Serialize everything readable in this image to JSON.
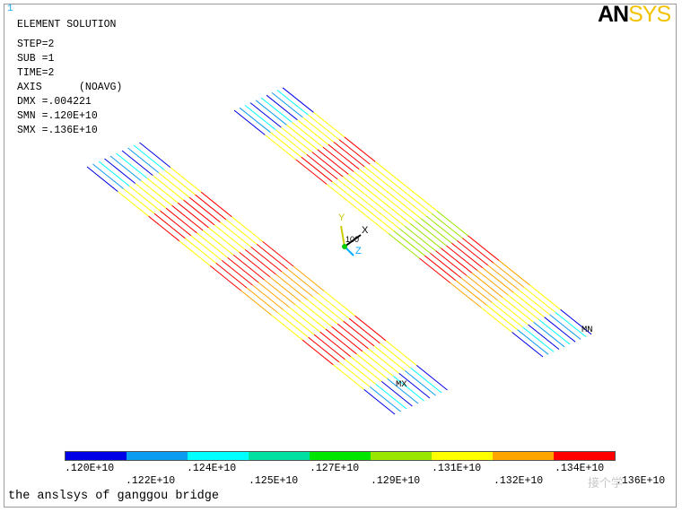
{
  "window_number": "1",
  "logo": {
    "black": "AN",
    "yellow": "SYS"
  },
  "info": {
    "heading": "ELEMENT SOLUTION",
    "lines": [
      "STEP=2",
      "SUB =1",
      "TIME=2",
      "AXIS      (NOAVG)",
      "DMX =.004221",
      "SMN =.120E+10",
      "SMX =.136E+10"
    ]
  },
  "markers": {
    "mx": "MX",
    "mn": "MN"
  },
  "triad": {
    "x": "X",
    "y": "Y",
    "z": "Z",
    "num": "100"
  },
  "legend": {
    "colors": [
      "#0000e6",
      "#0a9cf0",
      "#00ffff",
      "#00e0a0",
      "#00e600",
      "#99e600",
      "#ffff00",
      "#ffa500",
      "#ff0000"
    ],
    "ticks_top": [
      ".120E+10",
      ".124E+10",
      ".127E+10",
      ".131E+10",
      ".134E+10"
    ],
    "ticks_bottom": [
      ".122E+10",
      ".125E+10",
      ".129E+10",
      ".132E+10",
      ".136E+10"
    ]
  },
  "title": "the anslsys of ganggou bridge",
  "watermark": "接个学"
}
